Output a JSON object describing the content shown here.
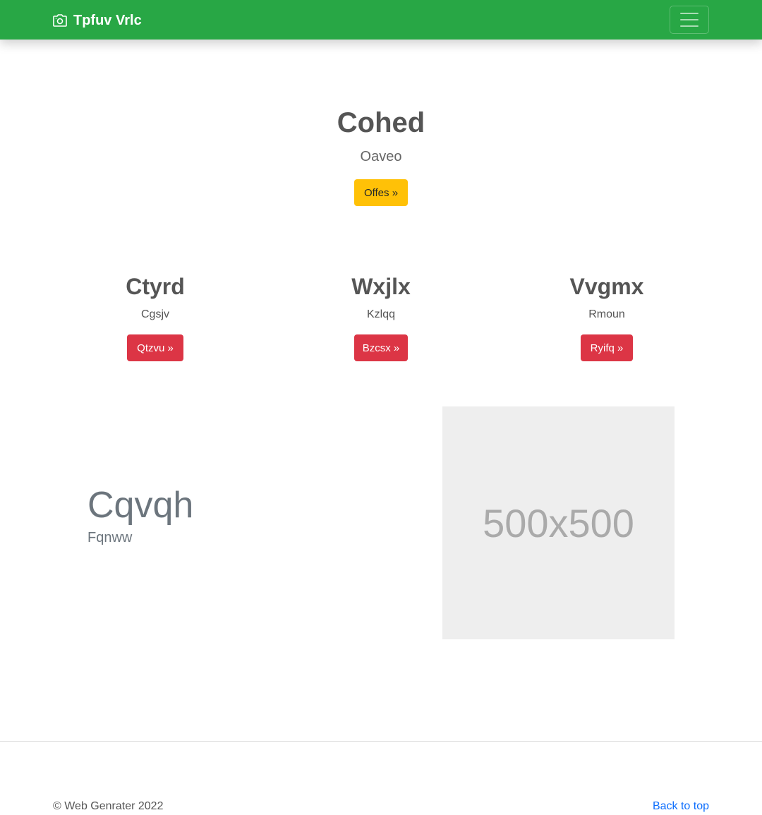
{
  "navbar": {
    "brand_icon": "camera-icon",
    "brand": "Tpfuv Vrlc",
    "toggler_icon": "hamburger-menu-icon"
  },
  "hero": {
    "title": "Cohed",
    "subtitle": "Oaveo",
    "button": "Offes »"
  },
  "features": [
    {
      "title": "Ctyrd",
      "subtitle": "Cgsjv",
      "button": "Qtzvu »"
    },
    {
      "title": "Wxjlx",
      "subtitle": "Kzlqq",
      "button": "Bzcsx »"
    },
    {
      "title": "Vvgmx",
      "subtitle": "Rmoun",
      "button": "Ryifq »"
    }
  ],
  "showcase": {
    "title": "Cqvqh",
    "subtitle": "Fqnww",
    "image_label": "500x500"
  },
  "footer": {
    "copyright": "© Web Genrater 2022",
    "back_to_top": "Back to top"
  },
  "colors": {
    "navbar": "#28a745",
    "warning": "#ffc107",
    "danger": "#dc3545",
    "link": "#0d6efd",
    "placeholder_bg": "#eeeeee"
  }
}
